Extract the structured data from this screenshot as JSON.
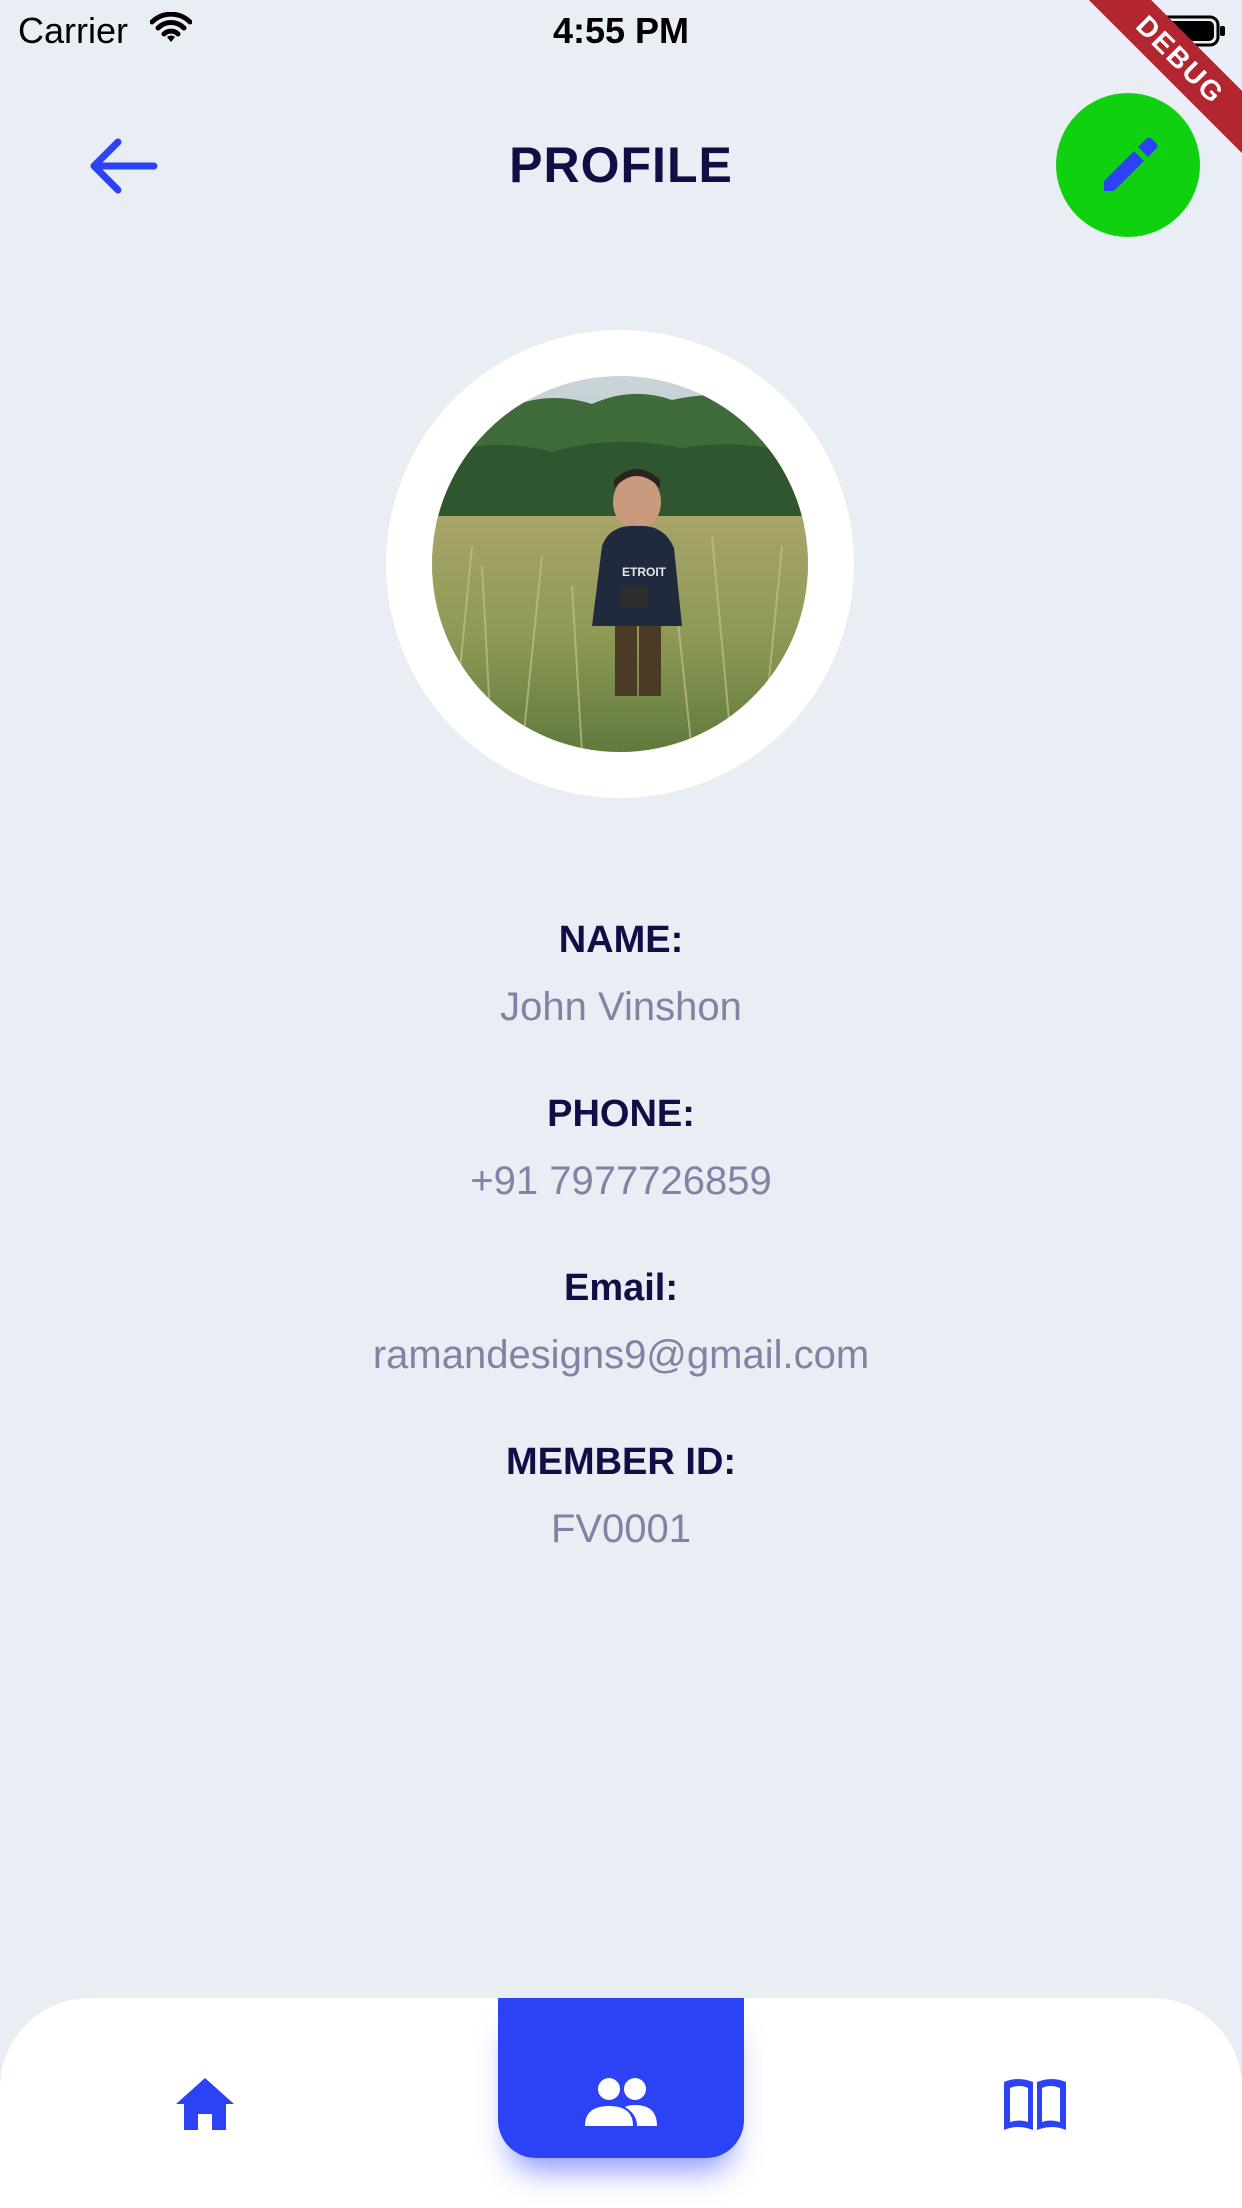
{
  "status_bar": {
    "carrier": "Carrier",
    "time": "4:55 PM"
  },
  "debug_banner": "DEBUG",
  "header": {
    "title": "PROFILE",
    "back_icon": "arrow-left-icon",
    "edit_icon": "pencil-icon"
  },
  "profile": {
    "fields": [
      {
        "label": "NAME:",
        "value": "John Vinshon"
      },
      {
        "label": "PHONE:",
        "value": "+91 7977726859"
      },
      {
        "label": "Email:",
        "value": "ramandesigns9@gmail.com"
      },
      {
        "label": "MEMBER ID:",
        "value": "FV0001"
      }
    ]
  },
  "bottom_nav": {
    "items": [
      {
        "icon": "home-icon",
        "active": false
      },
      {
        "icon": "people-icon",
        "active": true
      },
      {
        "icon": "book-icon",
        "active": false
      }
    ]
  },
  "colors": {
    "background": "#e9edf4",
    "accent": "#2c43f5",
    "edit_button": "#0fd10f",
    "title": "#0f0f45",
    "value_text": "#8083a3"
  }
}
